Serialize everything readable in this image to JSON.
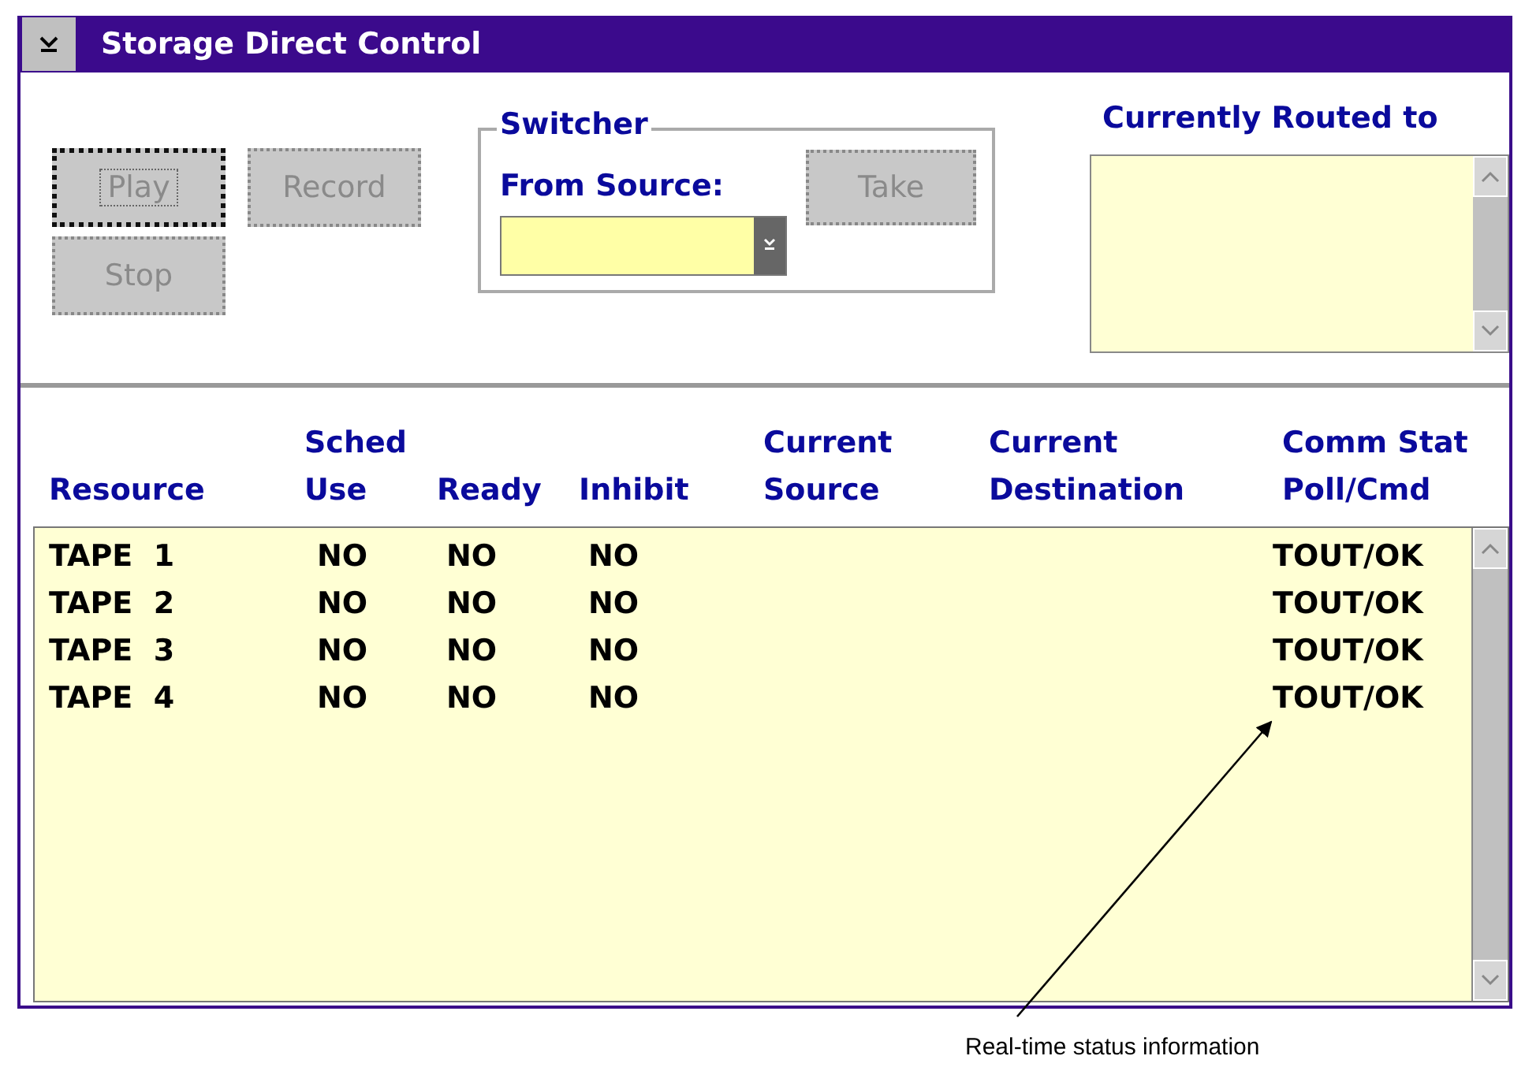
{
  "window": {
    "title": "Storage Direct Control"
  },
  "transport_buttons": [
    {
      "label": "Play",
      "disabled": true,
      "focused": true
    },
    {
      "label": "Record",
      "disabled": true,
      "focused": false
    },
    {
      "label": "Stop",
      "disabled": true,
      "focused": false
    }
  ],
  "switcher": {
    "title": "Switcher",
    "label": "From Source:",
    "take_button": {
      "label": "Take",
      "disabled": true
    }
  },
  "routed": {
    "label": "Currently Routed to"
  },
  "table": {
    "columns": [
      "Resource",
      "Sched\nUse",
      "Ready",
      "Inhibit",
      "Current\nSource",
      "Current\nDestination",
      "Comm Stat\nPoll/Cmd"
    ],
    "rows": [
      [
        "TAPE  1",
        "NO",
        "NO",
        "NO",
        "",
        "",
        "TOUT/OK"
      ],
      [
        "TAPE  2",
        "NO",
        "NO",
        "NO",
        "",
        "",
        "TOUT/OK"
      ],
      [
        "TAPE  3",
        "NO",
        "NO",
        "NO",
        "",
        "",
        "TOUT/OK"
      ],
      [
        "TAPE  4",
        "NO",
        "NO",
        "NO",
        "",
        "",
        "TOUT/OK"
      ]
    ]
  },
  "annotation": {
    "text": "Real-time status information"
  }
}
